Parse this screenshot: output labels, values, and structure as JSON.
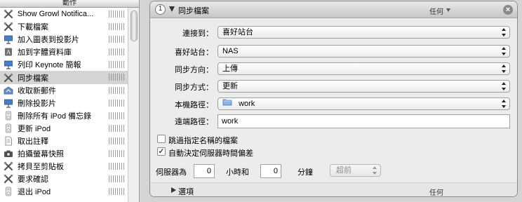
{
  "sidebar": {
    "header": "動作",
    "items": [
      {
        "label": "Show Growl Notifica...",
        "icon": "tools-icon"
      },
      {
        "label": "下載檔案",
        "icon": "tools-icon"
      },
      {
        "label": "加入圖表到投影片",
        "icon": "keynote-icon"
      },
      {
        "label": "加到字體資料庫",
        "icon": "font-book-icon"
      },
      {
        "label": "列印 Keynote 簡報",
        "icon": "keynote-icon"
      },
      {
        "label": "同步檔案",
        "icon": "tools-icon",
        "selected": true
      },
      {
        "label": "收取新郵件",
        "icon": "mail-icon"
      },
      {
        "label": "刪除投影片",
        "icon": "keynote-icon"
      },
      {
        "label": "刪除所有 iPod 備忘錄",
        "icon": "ipod-icon"
      },
      {
        "label": "更新 iPod",
        "icon": "ipod-icon"
      },
      {
        "label": "取出註釋",
        "icon": "document-icon"
      },
      {
        "label": "拍攝螢幕快照",
        "icon": "camera-icon"
      },
      {
        "label": "拷貝至剪貼板",
        "icon": "tools-icon"
      },
      {
        "label": "要求確認",
        "icon": "tools-icon"
      },
      {
        "label": "退出 iPod",
        "icon": "ipod-icon"
      }
    ]
  },
  "panel": {
    "step": "1",
    "title": "同步檔案",
    "header_any": "任何",
    "close": "×",
    "connect_label": "連接到：",
    "connect_value": "喜好站台",
    "favorite_label": "喜好站台：",
    "favorite_value": "NAS",
    "direction_label": "同步方向：",
    "direction_value": "上傳",
    "method_label": "同步方式：",
    "method_value": "更新",
    "local_label": "本機路徑：",
    "local_value": "work",
    "local_icon": "folder-icon",
    "remote_label": "遠端路徑：",
    "remote_value": "work",
    "skip_check": "",
    "skip_label": "跳過指定名稱的檔案",
    "auto_check": "✓",
    "auto_label": "自動決定伺服器時間偏差",
    "offset_label": "伺服器為",
    "hours_value": "0",
    "hours_label": "小時和",
    "minutes_value": "0",
    "minutes_label": "分鐘",
    "direction_popup": "超前",
    "options_label": "選項",
    "options_any": "任何"
  }
}
